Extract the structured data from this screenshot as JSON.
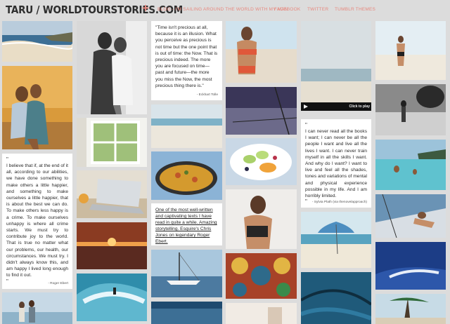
{
  "site": {
    "logo": "TARU / WORLDTOURSTORIES.COM",
    "plus": "+"
  },
  "nav": [
    {
      "label": "BLOG - I'M SAILING AROUND THE WORLD WITH MY MAN"
    },
    {
      "label": "FACEBOOK"
    },
    {
      "label": "TWITTER"
    },
    {
      "label": "TUMBLR THEMES"
    }
  ],
  "quotes": {
    "tolle": {
      "text": "\"Time isn't precious at all, because it is an illusion. What you perceive as precious is not time but the one point that is out of time: the Now. That is precious indeed. The more you are focused on time—past and future—the more you miss the Now, the most precious thing there is.\"",
      "author": "- Eckhart Tolle"
    },
    "ebert": {
      "mark": "\"",
      "text": "I believe that if, at the end of it all, according to our abilities, we have done something to make others a little happier, and something to make ourselves a little happier, that is about the best we can do. To make others less happy is a crime. To make ourselves unhappy is where all crime starts. We must try to contribute joy to the world. That is true no matter what our problems, our health, our circumstances. We must try. I didn't always know this, and am happy I lived long enough to find it out.",
      "close": "\"",
      "author": "- Roger Ebert"
    },
    "plath": {
      "mark": "\"",
      "text": "I can never read all the books I want; I can never be all the people I want and live all the lives I want. I can never train myself in all the skills I want. And why do I want? I want to live and feel all the shades, tones and variations of mental and physical experience possible in my life. And I am horribly limited.",
      "close": "\"",
      "author": "- Sylvia Plath (via thenovelapproach)"
    },
    "esquire": {
      "text": "One of the most well-written and captivating texts I have read in quite a while. Amazing storytelling. Esquire's Chris Jones on legendary Roger Ebert."
    }
  },
  "video": {
    "label": "Click to play"
  },
  "colors": {
    "background": "#dcdcdc",
    "accent": "#e7897f",
    "text": "#2e2e2e"
  }
}
